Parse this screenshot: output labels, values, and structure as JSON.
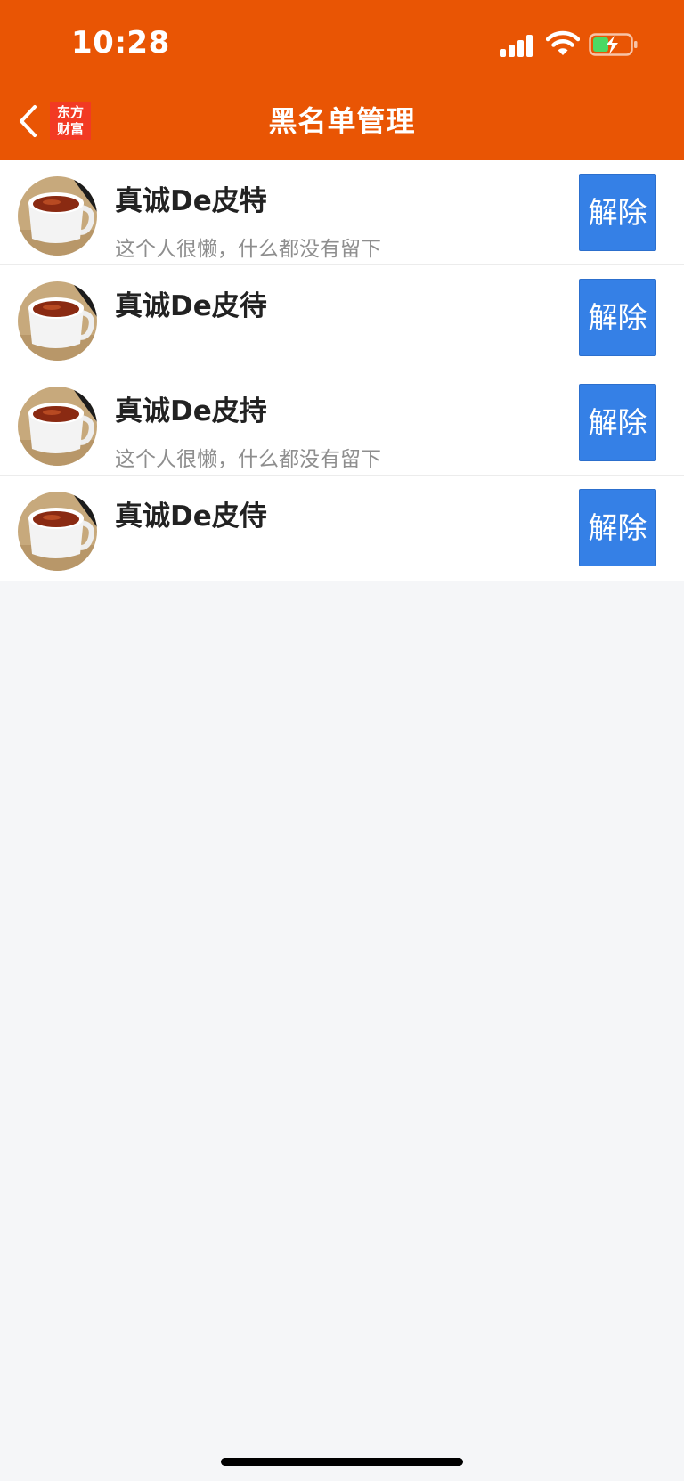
{
  "status_bar": {
    "time": "10:28"
  },
  "header": {
    "title": "黑名单管理",
    "logo_line1": "东方",
    "logo_line2": "财富",
    "brand_color": "#e95504"
  },
  "blacklist": [
    {
      "name": "真诚De皮特",
      "bio": "这个人很懒，什么都没有留下",
      "button_label": "解除"
    },
    {
      "name": "真诚De皮待",
      "bio": "",
      "button_label": "解除"
    },
    {
      "name": "真诚De皮持",
      "bio": "这个人很懒，什么都没有留下",
      "button_label": "解除"
    },
    {
      "name": "真诚De皮侍",
      "bio": "",
      "button_label": "解除"
    }
  ],
  "colors": {
    "button": "#3580e6",
    "background": "#f5f6f8"
  },
  "icons": {
    "back": "chevron-left-icon",
    "signal": "cellular-signal-icon",
    "wifi": "wifi-icon",
    "battery": "battery-charging-icon",
    "avatar": "tea-cup-photo"
  }
}
